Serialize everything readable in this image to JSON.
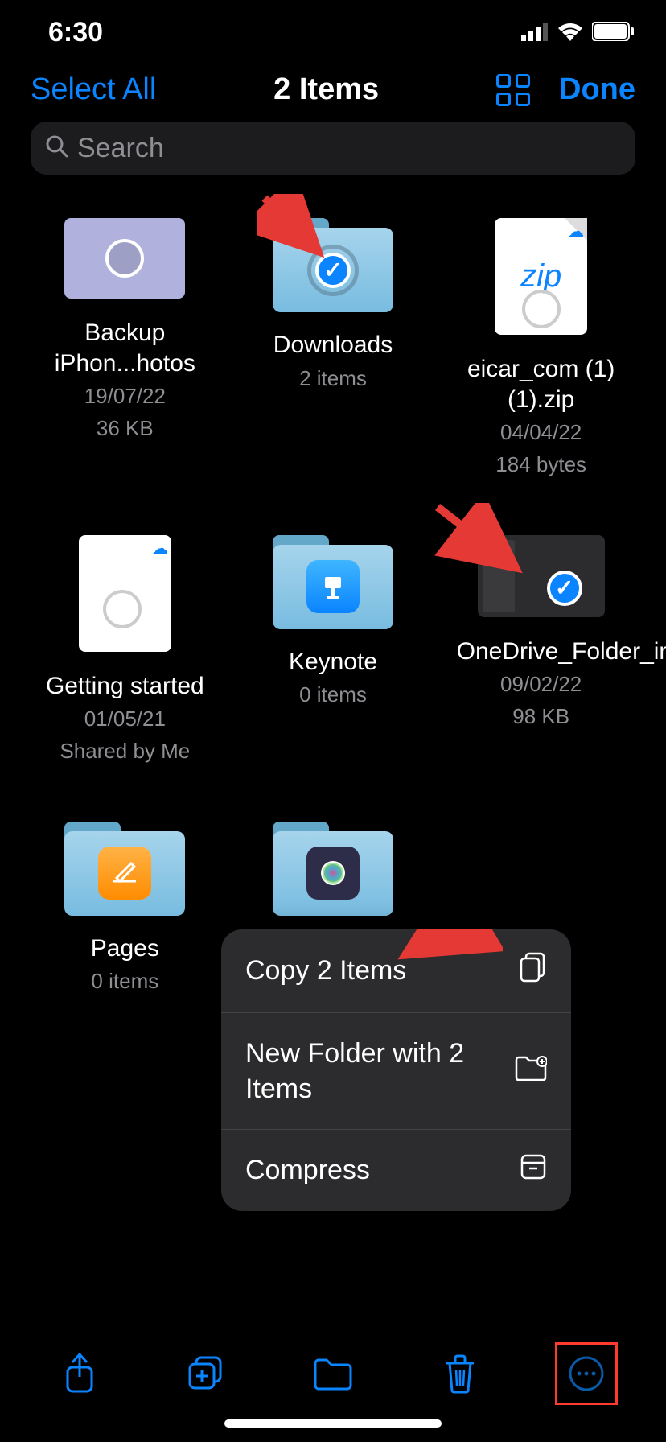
{
  "status": {
    "time": "6:30"
  },
  "nav": {
    "left": "Select All",
    "title": "2 Items",
    "done": "Done"
  },
  "search": {
    "placeholder": "Search"
  },
  "items": [
    {
      "name": "Backup iPhon...hotos",
      "line1": "19/07/22",
      "line2": "36 KB"
    },
    {
      "name": "Downloads",
      "line1": "2 items",
      "line2": ""
    },
    {
      "name": "eicar_com (1) (1).zip",
      "line1": "04/04/22",
      "line2": "184 bytes"
    },
    {
      "name": "Getting started",
      "line1": "01/05/21",
      "line2": "Shared by Me"
    },
    {
      "name": "Keynote",
      "line1": "0 items",
      "line2": ""
    },
    {
      "name": "OneDrive_Folder_in_Finder",
      "line1": "09/02/22",
      "line2": "98 KB"
    },
    {
      "name": "Pages",
      "line1": "0 items",
      "line2": ""
    }
  ],
  "menu": {
    "copy": "Copy 2 Items",
    "newfolder": "New Folder with 2 Items",
    "compress": "Compress"
  }
}
